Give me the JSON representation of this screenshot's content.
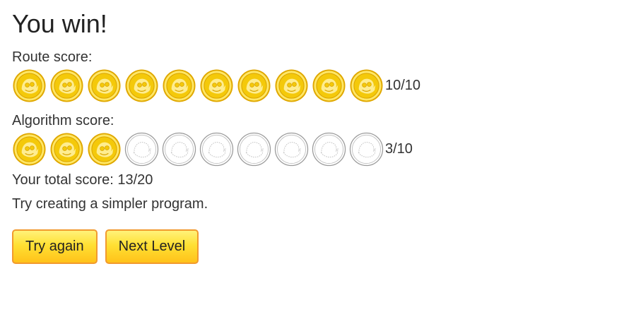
{
  "title": "You win!",
  "route": {
    "label": "Route score:",
    "earned": 10,
    "total": 10,
    "score_text": "10/10"
  },
  "algorithm": {
    "label": "Algorithm score:",
    "earned": 3,
    "total": 10,
    "score_text": "3/10"
  },
  "total_score_text": "Your total score: 13/20",
  "hint": "Try creating a simpler program.",
  "buttons": {
    "try_again": "Try again",
    "next_level": "Next Level"
  },
  "colors": {
    "coin_gold": "#f4c90a",
    "coin_rim": "#e0a800",
    "coin_empty": "#9a9a9a",
    "button_border": "#f29a2e",
    "button_fill": "#ffd21f"
  },
  "icons": {
    "earned": "gold-coin-icon",
    "empty": "empty-coin-icon"
  }
}
